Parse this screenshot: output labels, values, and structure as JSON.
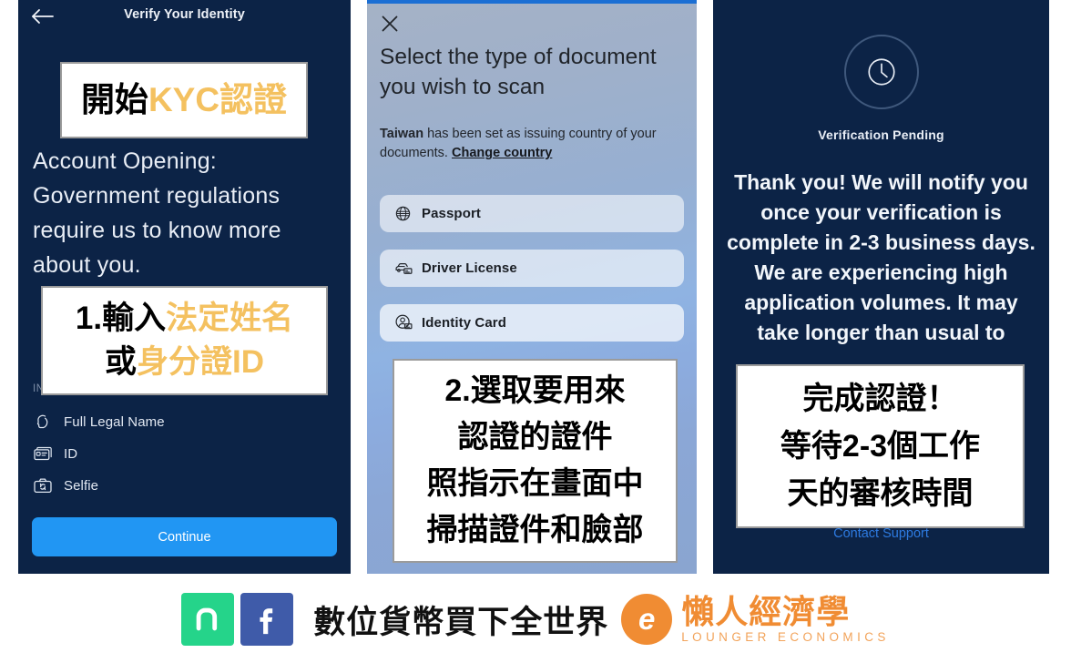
{
  "colors": {
    "panel_navy": "#0c2346",
    "accent_blue": "#2196f3",
    "highlight_gold": "#f4c160",
    "brand_orange": "#f08c33",
    "link_blue": "#2d7ae0"
  },
  "panel_one": {
    "back_icon": "back-arrow-icon",
    "title": "Verify Your Identity",
    "heading": "Account Opening: Government regulations require us to know more about you.",
    "info_label": "INFORMATION REQUIRED",
    "requirements": [
      {
        "icon": "head-profile-icon",
        "label": "Full Legal Name"
      },
      {
        "icon": "id-card-icon",
        "label": "ID"
      },
      {
        "icon": "selfie-camera-icon",
        "label": "Selfie"
      }
    ],
    "continue_label": "Continue"
  },
  "panel_two": {
    "close_icon": "close-x-icon",
    "heading": "Select the type of document you wish to scan",
    "country_prefix": "Taiwan",
    "country_text": " has been set as issuing country of your documents. ",
    "change_country_link": "Change country",
    "documents": [
      {
        "icon": "globe-icon",
        "label": "Passport"
      },
      {
        "icon": "car-license-icon",
        "label": "Driver License"
      },
      {
        "icon": "identity-card-icon",
        "label": "Identity Card"
      }
    ]
  },
  "panel_three": {
    "status_icon": "clock-icon",
    "status_label": "Verification Pending",
    "body": "Thank you! We will notify you once your verification is complete in 2-3 business days. We are experiencing high application volumes. It may take longer than usual to",
    "contact_link": "Contact Support"
  },
  "annotations": {
    "one": {
      "plain": "開始",
      "highlight": "KYC認證"
    },
    "two": {
      "line1_plain": "1.輸入",
      "line1_highlight": "法定姓名",
      "line2_plain": "或",
      "line2_highlight": "身分證ID"
    },
    "three": {
      "line1": "2.選取要用來",
      "line2": "認證的證件",
      "line3": "照指示在畫面中",
      "line4": "掃描證件和臉部"
    },
    "four": {
      "line1": "完成認證！",
      "line2": "等待2-3個工作",
      "line3": "天的審核時間"
    }
  },
  "footer": {
    "social": [
      {
        "icon": "line-app-icon",
        "name": "LINE"
      },
      {
        "icon": "facebook-icon",
        "name": "Facebook"
      }
    ],
    "slogan": "數位貨幣買下全世界",
    "brand_mark": "e",
    "brand_cn": "懶人經濟學",
    "brand_en": "LOUNGER ECONOMICS"
  }
}
